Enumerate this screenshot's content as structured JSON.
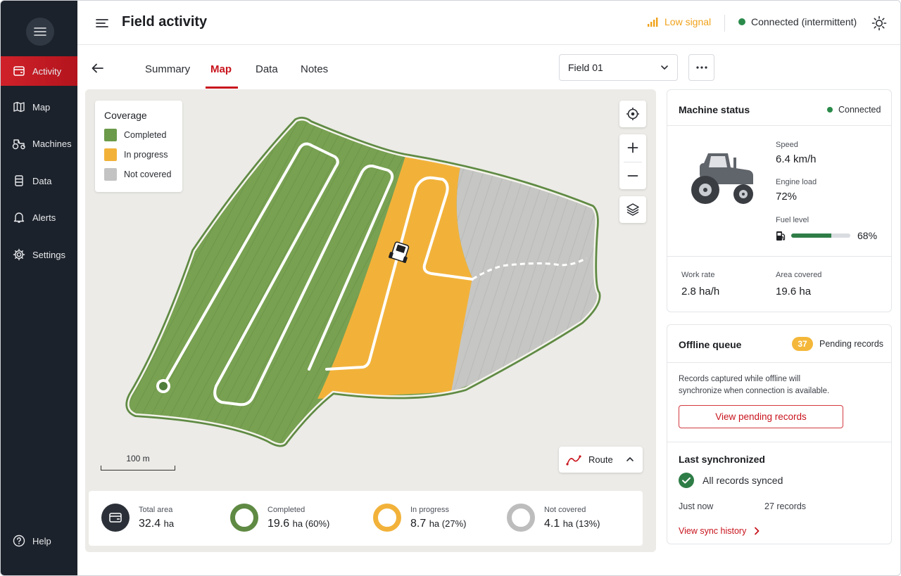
{
  "sidebar": {
    "items": [
      {
        "label": "Activity",
        "icon": "activity-icon",
        "active": true
      },
      {
        "label": "Map",
        "icon": "map-icon"
      },
      {
        "label": "Machines",
        "icon": "tractor-icon"
      },
      {
        "label": "Data",
        "icon": "database-icon"
      },
      {
        "label": "Alerts",
        "icon": "bell-icon"
      },
      {
        "label": "Settings",
        "icon": "gear-icon"
      }
    ],
    "help_label": "Help"
  },
  "header": {
    "title": "Field activity",
    "signal_label": "Low signal",
    "connection_label": "Connected (intermittent)"
  },
  "tabs": [
    {
      "label": "Summary"
    },
    {
      "label": "Map",
      "active": true
    },
    {
      "label": "Data"
    },
    {
      "label": "Notes"
    }
  ],
  "field_select": {
    "value": "Field 01"
  },
  "map": {
    "legend": {
      "title": "Coverage",
      "items": [
        {
          "label": "Completed",
          "color": "#6b9a4a"
        },
        {
          "label": "In progress",
          "color": "#f2b23a"
        },
        {
          "label": "Not covered",
          "color": "#c3c3c3"
        }
      ]
    },
    "scale_label": "100 m",
    "route_label": "Route"
  },
  "stats": {
    "total": {
      "label": "Total area",
      "value": "32.4",
      "unit": "ha"
    },
    "completed": {
      "label": "Completed",
      "value": "19.6",
      "unit": "ha (60%)"
    },
    "in_progress": {
      "label": "In progress",
      "value": "8.7",
      "unit": "ha (27%)"
    },
    "not_covered": {
      "label": "Not covered",
      "value": "4.1",
      "unit": "ha (13%)"
    }
  },
  "machine_status": {
    "title": "Machine status",
    "status": "Connected",
    "speed_label": "Speed",
    "speed_value": "6.4 km/h",
    "engine_label": "Engine load",
    "engine_value": "72%",
    "fuel_label": "Fuel level",
    "fuel_value": "68%",
    "fuel_fraction": 0.68,
    "work_rate_label": "Work rate",
    "work_rate_value": "2.8 ha/h",
    "area_covered_label": "Area covered",
    "area_covered_value": "19.6 ha"
  },
  "offline_queue": {
    "title": "Offline queue",
    "count": "37",
    "count_label": "Pending records",
    "description_line1": "Records captured while offline will",
    "description_line2": "synchronize when connection is available.",
    "button_label": "View pending records"
  },
  "last_sync": {
    "title": "Last synchronized",
    "status": "All records synced",
    "time": "Just now",
    "records": "27 records",
    "history_link": "View sync history"
  },
  "colors": {
    "accent": "#c8141d",
    "completed": "#6b9a4a",
    "in_progress": "#f2b23a",
    "not_covered": "#c3c3c3",
    "connected": "#2a8a4a"
  }
}
